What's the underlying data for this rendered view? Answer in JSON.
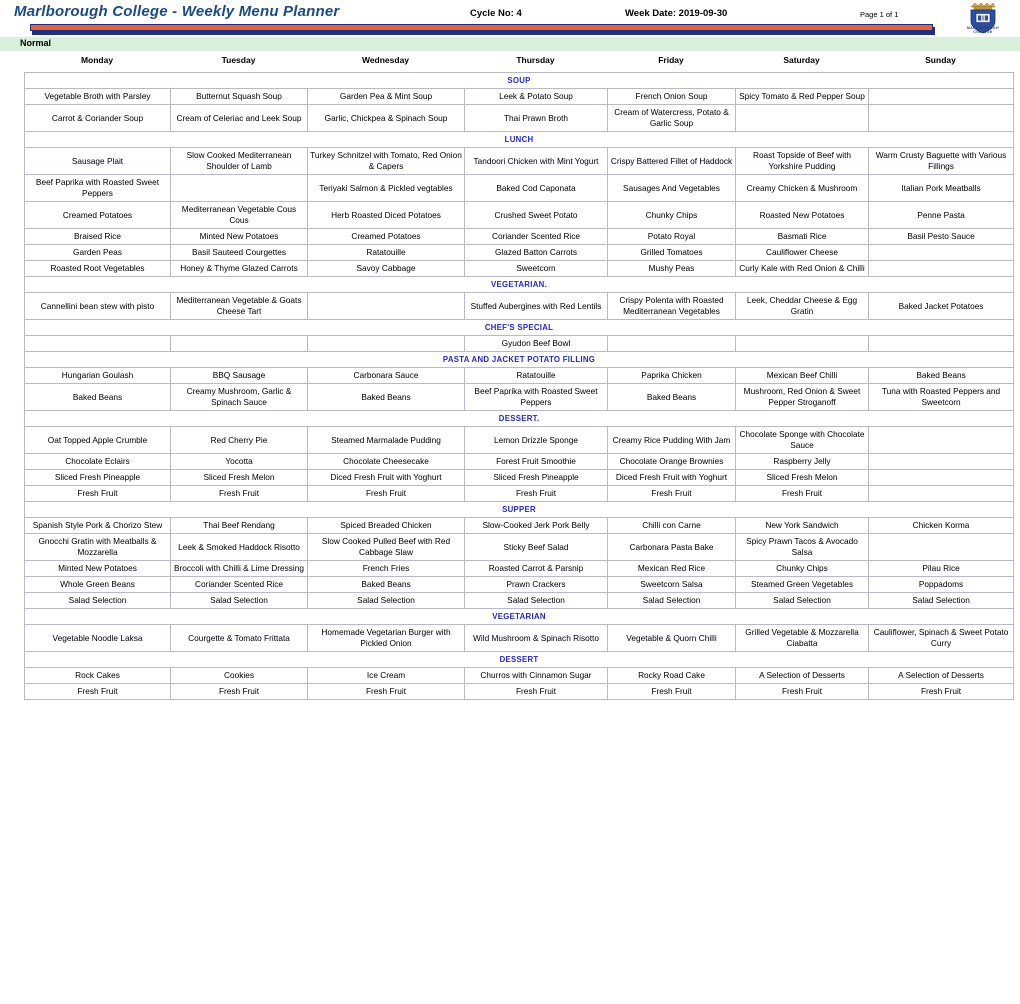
{
  "header": {
    "title": "Marlborough College - Weekly Menu Planner",
    "cycle": "Cycle No: 4",
    "week_date": "Week Date: 2019-09-30",
    "page": "Page 1 of 1",
    "logo_name": "marlborough-college-crest",
    "logo_caption": "MARLBOROUGH COLLEGE",
    "rule_orange_color": "#e8622a",
    "rule_navy_color": "#1c2f8c",
    "title_color": "#1a4a8a"
  },
  "band": {
    "label": "Normal",
    "color": "#d9f0da"
  },
  "days": [
    "Monday",
    "Tuesday",
    "Wednesday",
    "Thursday",
    "Friday",
    "Saturday",
    "Sunday"
  ],
  "section_style": {
    "background": "#e2e0fa",
    "text_color": "#2525dd"
  },
  "sections": [
    {
      "title": "SOUP",
      "rows": [
        [
          "Vegetable Broth with Parsley",
          "Butternut Squash Soup",
          "Garden Pea & Mint Soup",
          "Leek & Potato Soup",
          "French Onion Soup",
          "Spicy Tomato & Red Pepper Soup",
          ""
        ],
        [
          "Carrot & Coriander Soup",
          "Cream of Celeriac and Leek Soup",
          "Garlic, Chickpea & Spinach Soup",
          "Thai Prawn Broth",
          "Cream of Watercress, Potato & Garlic Soup",
          "",
          ""
        ]
      ]
    },
    {
      "title": "LUNCH",
      "rows": [
        [
          "Sausage Plait",
          "Slow Cooked Mediterranean Shoulder of Lamb",
          "Turkey Schnitzel with Tomato, Red Onion & Capers",
          "Tandoori Chicken with Mint Yogurt",
          "Crispy Battered Fillet of Haddock",
          "Roast Topside of Beef with Yorkshire Pudding",
          "Warm Crusty Baguette with Various Fillings"
        ],
        [
          "Beef Paprika with Roasted Sweet Peppers",
          "",
          "Teriyaki Salmon & Pickled vegtables",
          "Baked Cod Caponata",
          "Sausages And Vegetables",
          "Creamy Chicken & Mushroom",
          "Italian Pork Meatballs"
        ],
        [
          "Creamed Potatoes",
          "Mediterranean Vegetable Cous Cous",
          "Herb Roasted Diced Potatoes",
          "Crushed Sweet Potato",
          "Chunky Chips",
          "Roasted New Potatoes",
          "Penne Pasta"
        ],
        [
          "Braised Rice",
          "Minted New Potatoes",
          "Creamed Potatoes",
          "Coriander Scented Rice",
          "Potato Royal",
          "Basmati Rice",
          "Basil Pesto Sauce"
        ],
        [
          "Garden Peas",
          "Basil Sauteed Courgettes",
          "Ratatouille",
          "Glazed Batton Carrots",
          "Grilled Tomatoes",
          "Cauliflower Cheese",
          ""
        ],
        [
          "Roasted Root Vegetables",
          "Honey & Thyme Glazed Carrots",
          "Savoy Cabbage",
          "Sweetcorn",
          "Mushy Peas",
          "Curly Kale with Red Onion & Chilli",
          ""
        ]
      ]
    },
    {
      "title": "VEGETARIAN.",
      "rows": [
        [
          "Cannellini bean stew with pisto",
          "Mediterranean Vegetable & Goats Cheese Tart",
          "",
          "Stuffed Aubergines with Red Lentils",
          "Crispy Polenta with Roasted Mediterranean Vegetables",
          "Leek, Cheddar Cheese & Egg Gratin",
          "Baked Jacket Potatoes"
        ]
      ]
    },
    {
      "title": "CHEF'S SPECIAL",
      "rows": [
        [
          "",
          "",
          "",
          "Gyudon Beef Bowl",
          "",
          "",
          ""
        ]
      ]
    },
    {
      "title": "PASTA AND JACKET POTATO FILLING",
      "rows": [
        [
          "Hungarian Goulash",
          "BBQ Sausage",
          "Carbonara Sauce",
          "Ratatouille",
          "Paprika Chicken",
          "Mexican Beef Chilli",
          "Baked Beans"
        ],
        [
          "Baked Beans",
          "Creamy Mushroom, Garlic & Spinach Sauce",
          "Baked Beans",
          "Beef Paprika with Roasted Sweet Peppers",
          "Baked Beans",
          "Mushroom, Red Onion & Sweet Pepper Stroganoff",
          "Tuna with Roasted Peppers and Sweetcorn"
        ]
      ]
    },
    {
      "title": "DESSERT.",
      "rows": [
        [
          "Oat Topped Apple Crumble",
          "Red Cherry Pie",
          "Steamed Marmalade Pudding",
          "Lemon Drizzle Sponge",
          "Creamy Rice Pudding With Jam",
          "Chocolate Sponge with Chocolate Sauce",
          ""
        ],
        [
          "Chocolate Eclairs",
          "Yocotta",
          "Chocolate Cheesecake",
          "Forest Fruit Smoothie",
          "Chocolate Orange Brownies",
          "Raspberry Jelly",
          ""
        ],
        [
          "Sliced Fresh Pineapple",
          "Sliced Fresh Melon",
          "Diced Fresh Fruit with Yoghurt",
          "Sliced Fresh Pineapple",
          "Diced Fresh Fruit with Yoghurt",
          "Sliced Fresh Melon",
          ""
        ],
        [
          "Fresh Fruit",
          "Fresh Fruit",
          "Fresh Fruit",
          "Fresh Fruit",
          "Fresh Fruit",
          "Fresh Fruit",
          ""
        ]
      ]
    },
    {
      "title": "SUPPER",
      "rows": [
        [
          "Spanish Style Pork & Chorizo Stew",
          "Thai Beef Rendang",
          "Spiced Breaded Chicken",
          "Slow-Cooked Jerk Pork Belly",
          "Chilli con Carne",
          "New York Sandwich",
          "Chicken Korma"
        ],
        [
          "Gnocchi Gratin with Meatballs & Mozzarella",
          "Leek & Smoked Haddock Risotto",
          "Slow Cooked Pulled Beef with Red Cabbage Slaw",
          "Sticky Beef Salad",
          "Carbonara Pasta Bake",
          "Spicy Prawn Tacos & Avocado Salsa",
          ""
        ],
        [
          "Minted New Potatoes",
          "Broccoli with Chilli & Lime Dressing",
          "French Fries",
          "Roasted Carrot & Parsnip",
          "Mexican Red Rice",
          "Chunky Chips",
          "Pilau Rice"
        ],
        [
          "Whole Green Beans",
          "Coriander Scented Rice",
          "Baked Beans",
          "Prawn Crackers",
          "Sweetcorn Salsa",
          "Steamed Green Vegetables",
          "Poppadoms"
        ],
        [
          "Salad Selection",
          "Salad Selection",
          "Salad Selection",
          "Salad Selection",
          "Salad Selection",
          "Salad Selection",
          "Salad Selection"
        ]
      ]
    },
    {
      "title": "VEGETARIAN",
      "rows": [
        [
          "Vegetable Noodle Laksa",
          "Courgette & Tomato Frittata",
          "Homemade Vegetarian Burger with Pickled Onion",
          "Wild Mushroom & Spinach Risotto",
          "Vegetable & Quorn Chilli",
          "Grilled Vegetable & Mozzarella Ciabatta",
          "Cauliflower, Spinach & Sweet Potato Curry"
        ]
      ]
    },
    {
      "title": "DESSERT",
      "rows": [
        [
          "Rock Cakes",
          "Cookies",
          "Ice Cream",
          "Churros with Cinnamon Sugar",
          "Rocky Road Cake",
          "A Selection of Desserts",
          "A Selection of Desserts"
        ],
        [
          "Fresh Fruit",
          "Fresh Fruit",
          "Fresh Fruit",
          "Fresh Fruit",
          "Fresh Fruit",
          "Fresh Fruit",
          "Fresh Fruit"
        ]
      ]
    }
  ]
}
